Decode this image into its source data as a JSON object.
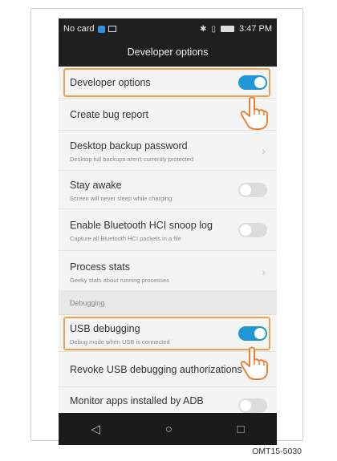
{
  "status_bar": {
    "carrier": "No card",
    "time": "3:47 PM",
    "icons": [
      "sim-icon",
      "image-icon",
      "bluetooth-icon",
      "vibrate-icon",
      "battery-icon"
    ]
  },
  "title": "Developer options",
  "settings": {
    "developer_options": {
      "label": "Developer options",
      "enabled": true
    },
    "create_bug_report": {
      "label": "Create bug report"
    },
    "desktop_backup_password": {
      "label": "Desktop backup password",
      "summary": "Desktop full backups aren't currently protected"
    },
    "stay_awake": {
      "label": "Stay awake",
      "summary": "Screen will never sleep while charging",
      "enabled": false
    },
    "bt_hci_log": {
      "label": "Enable Bluetooth HCI snoop log",
      "summary": "Capture all Bluetooth HCI packets in a file",
      "enabled": false
    },
    "process_stats": {
      "label": "Process stats",
      "summary": "Geeky stats about running processes"
    },
    "section_debugging": "Debugging",
    "usb_debugging": {
      "label": "USB debugging",
      "summary": "Debug mode when USB is connected",
      "enabled": true
    },
    "revoke_usb": {
      "label": "Revoke USB debugging authorizations"
    },
    "monitor_apps": {
      "label": "Monitor apps installed by ADB"
    }
  },
  "nav": {
    "back": "◁",
    "home": "○",
    "recent": "□"
  },
  "caption": "OMT15-5030",
  "colors": {
    "accent": "#1f97d6",
    "highlight": "#f0a14a",
    "bar": "#1f1f1f"
  }
}
